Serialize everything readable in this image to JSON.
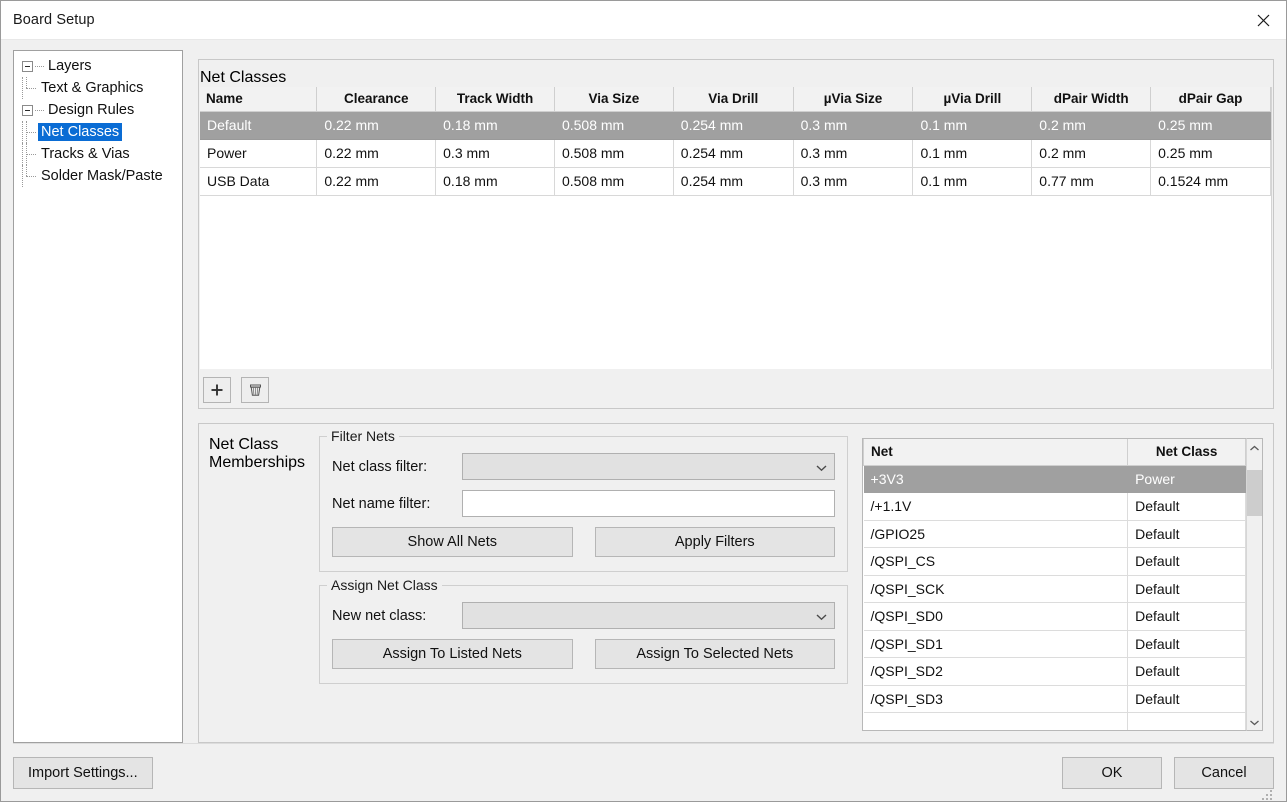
{
  "window": {
    "title": "Board Setup",
    "close_icon": "close-icon"
  },
  "sidebar": {
    "items": [
      {
        "label": "Layers",
        "level": 0,
        "expandable": true,
        "selected": false
      },
      {
        "label": "Text & Graphics",
        "level": 1,
        "expandable": false,
        "selected": false
      },
      {
        "label": "Design Rules",
        "level": 0,
        "expandable": true,
        "selected": false
      },
      {
        "label": "Net Classes",
        "level": 1,
        "expandable": false,
        "selected": true
      },
      {
        "label": "Tracks & Vias",
        "level": 1,
        "expandable": false,
        "selected": false
      },
      {
        "label": "Solder Mask/Paste",
        "level": 1,
        "expandable": false,
        "selected": false
      }
    ]
  },
  "net_classes": {
    "group_title": "Net Classes",
    "columns": [
      "Name",
      "Clearance",
      "Track Width",
      "Via Size",
      "Via Drill",
      "µVia Size",
      "µVia Drill",
      "dPair Width",
      "dPair Gap"
    ],
    "rows": [
      {
        "selected": true,
        "cells": [
          "Default",
          "0.22 mm",
          "0.18 mm",
          "0.508 mm",
          "0.254 mm",
          "0.3 mm",
          "0.1 mm",
          "0.2 mm",
          "0.25 mm"
        ]
      },
      {
        "selected": false,
        "cells": [
          "Power",
          "0.22 mm",
          "0.3 mm",
          "0.508 mm",
          "0.254 mm",
          "0.3 mm",
          "0.1 mm",
          "0.2 mm",
          "0.25 mm"
        ]
      },
      {
        "selected": false,
        "cells": [
          "USB Data",
          "0.22 mm",
          "0.18 mm",
          "0.508 mm",
          "0.254 mm",
          "0.3 mm",
          "0.1 mm",
          "0.77 mm",
          "0.1524 mm"
        ]
      }
    ],
    "toolbar": {
      "add_icon": "plus-icon",
      "delete_icon": "trash-icon"
    }
  },
  "memberships": {
    "group_title": "Net Class Memberships",
    "filter_nets": {
      "group_title": "Filter Nets",
      "net_class_filter_label": "Net class filter:",
      "net_class_filter_value": "",
      "net_name_filter_label": "Net name filter:",
      "net_name_filter_value": "",
      "net_name_filter_placeholder": "",
      "show_all_nets_label": "Show All Nets",
      "apply_filters_label": "Apply Filters"
    },
    "assign_net_class": {
      "group_title": "Assign Net Class",
      "new_net_class_label": "New net class:",
      "new_net_class_value": "",
      "assign_listed_label": "Assign To Listed Nets",
      "assign_selected_label": "Assign To Selected Nets"
    },
    "net_list": {
      "columns": [
        "Net",
        "Net Class"
      ],
      "rows": [
        {
          "net": "+3V3",
          "net_class": "Power",
          "selected": true
        },
        {
          "net": "/+1.1V",
          "net_class": "Default",
          "selected": false
        },
        {
          "net": "/GPIO25",
          "net_class": "Default",
          "selected": false
        },
        {
          "net": "/QSPI_CS",
          "net_class": "Default",
          "selected": false
        },
        {
          "net": "/QSPI_SCK",
          "net_class": "Default",
          "selected": false
        },
        {
          "net": "/QSPI_SD0",
          "net_class": "Default",
          "selected": false
        },
        {
          "net": "/QSPI_SD1",
          "net_class": "Default",
          "selected": false
        },
        {
          "net": "/QSPI_SD2",
          "net_class": "Default",
          "selected": false
        },
        {
          "net": "/QSPI_SD3",
          "net_class": "Default",
          "selected": false
        }
      ],
      "scroll_up_icon": "chevron-up-icon",
      "scroll_down_icon": "chevron-down-icon"
    }
  },
  "footer": {
    "import_settings_label": "Import Settings...",
    "ok_label": "OK",
    "cancel_label": "Cancel"
  },
  "colors": {
    "selection_blue": "#0a6cd4",
    "row_selected_gray": "#a0a0a0",
    "dialog_bg": "#f0f0f0"
  }
}
